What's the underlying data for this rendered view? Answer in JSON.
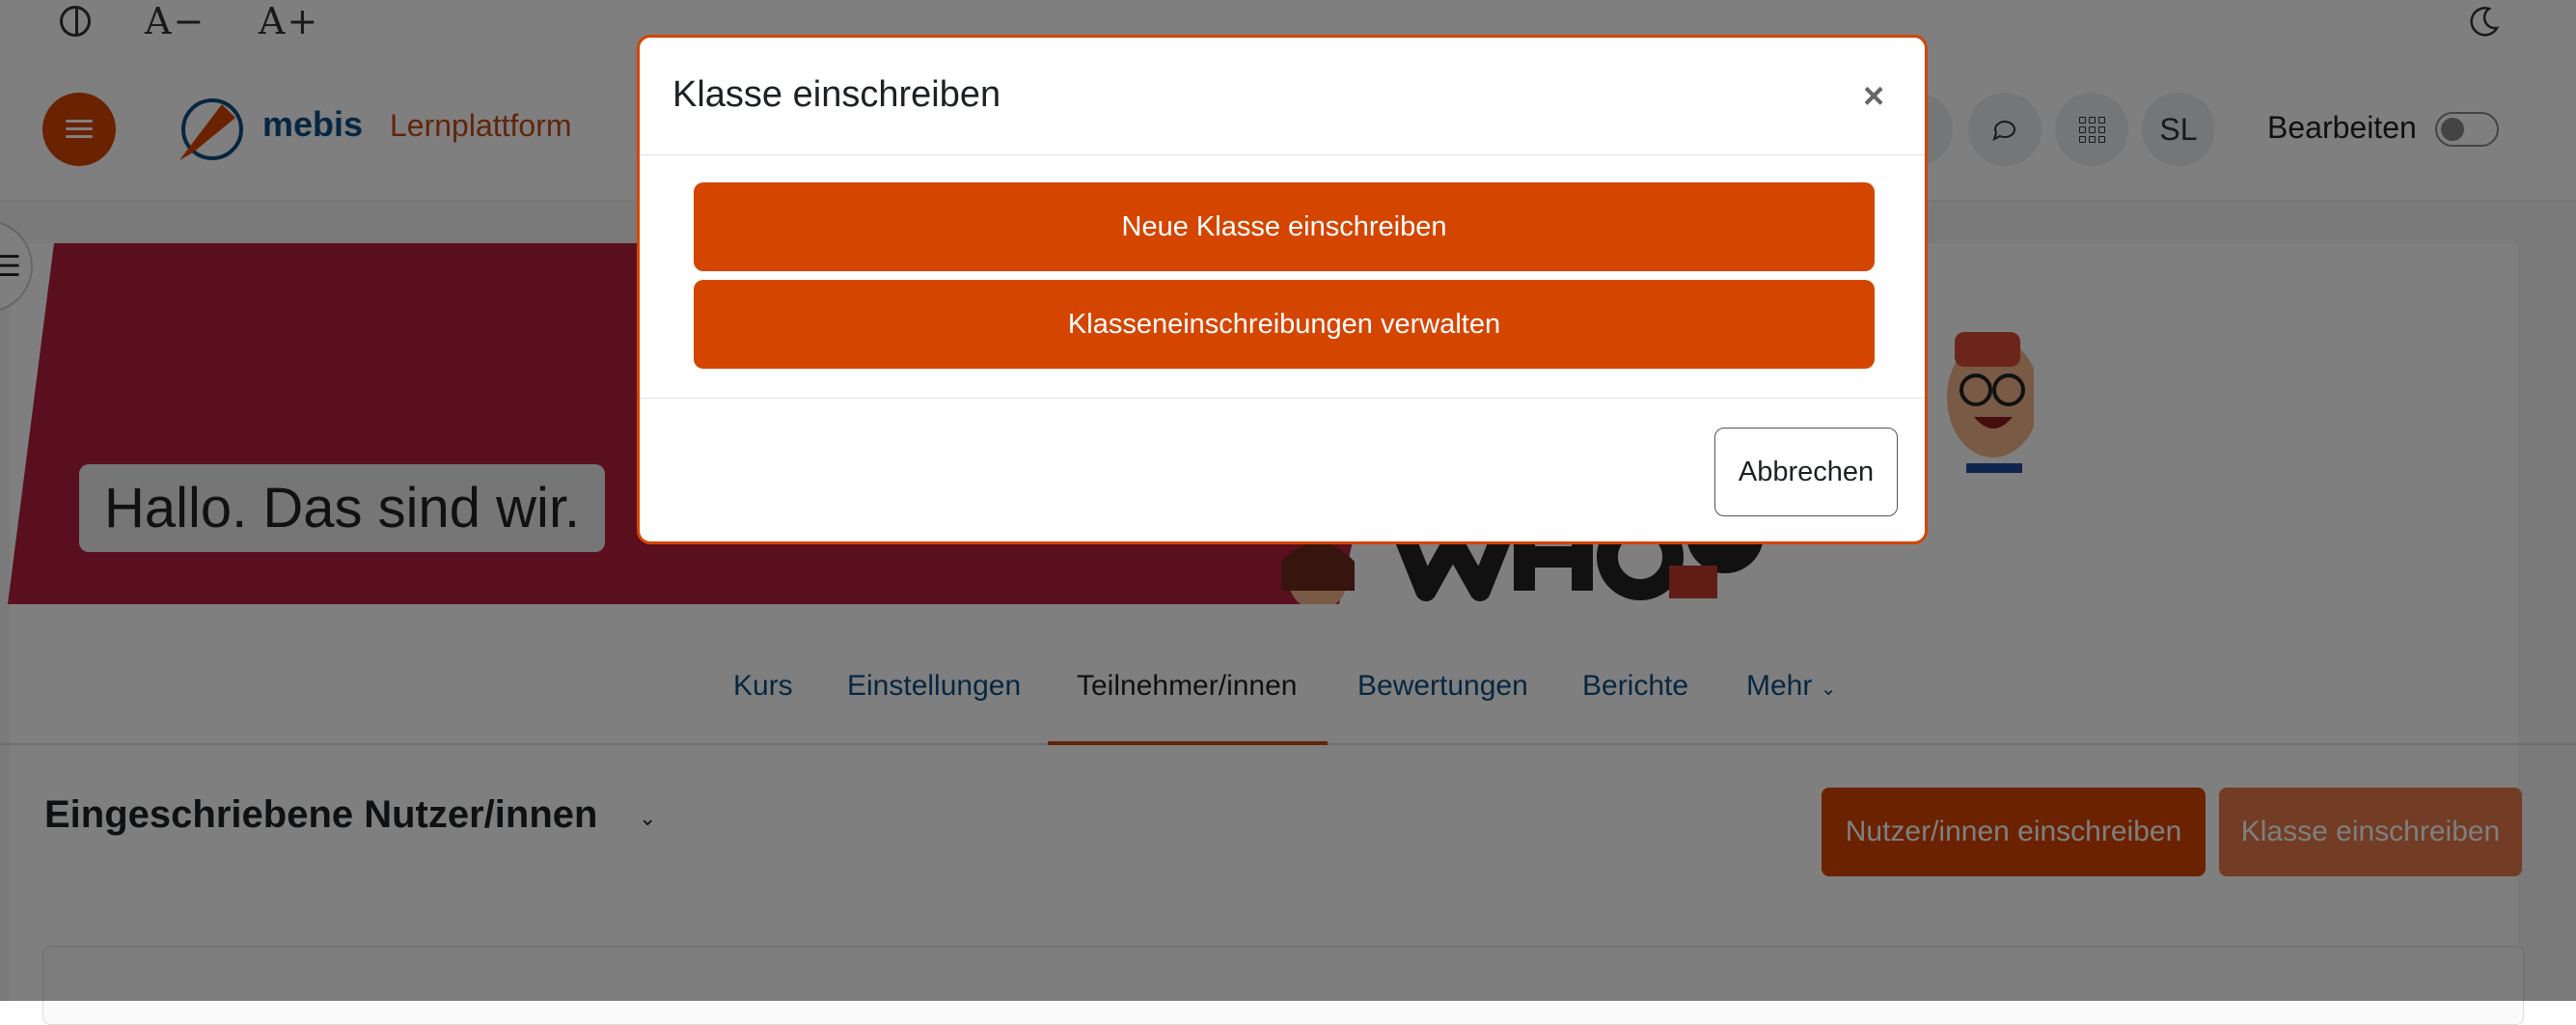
{
  "a11y": {
    "contrast_icon": "contrast-icon",
    "font_decrease": "A−",
    "font_increase": "A+",
    "dark_mode_icon": "moon-icon"
  },
  "navbar": {
    "brand_name": "mebis",
    "brand_sub": "Lernplattform",
    "avatar_initials": "SL",
    "edit_label": "Bearbeiten",
    "edit_enabled": false,
    "icons": [
      "menu-icon",
      "bell-icon",
      "chat-icon",
      "apps-grid-icon"
    ]
  },
  "banner": {
    "greeting": "Hallo. Das sind wir."
  },
  "course_nav": {
    "items": [
      "Kurs",
      "Einstellungen",
      "Teilnehmer/innen",
      "Bewertungen",
      "Berichte",
      "Mehr"
    ],
    "active_index": 2
  },
  "participants": {
    "title": "Eingeschriebene Nutzer/innen",
    "enrol_users_label": "Nutzer/innen einschreiben",
    "enrol_class_label": "Klasse einschreiben"
  },
  "modal": {
    "title": "Klasse einschreiben",
    "close_symbol": "×",
    "action_new": "Neue Klasse einschreiben",
    "action_manage": "Klasseneinschreibungen verwalten",
    "cancel_label": "Abbrechen"
  },
  "colors": {
    "accent": "#d44500",
    "brand_blue": "#0f4c81",
    "banner_red": "#b41e3f"
  }
}
